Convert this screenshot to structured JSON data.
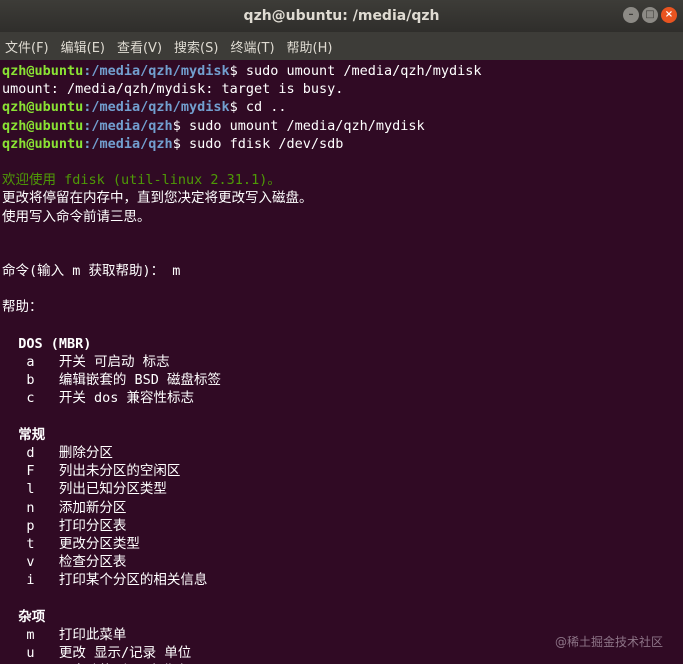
{
  "window": {
    "title": "qzh@ubuntu: /media/qzh",
    "controls": {
      "minimize": "–",
      "maximize": "□",
      "close": "×"
    }
  },
  "menu": [
    "文件(F)",
    "编辑(E)",
    "查看(V)",
    "搜索(S)",
    "终端(T)",
    "帮助(H)"
  ],
  "colors": {
    "background": "#300a24",
    "user": "#8ae234",
    "path": "#729fcf",
    "green": "#4e9a06"
  },
  "terminal": {
    "lines": [
      {
        "user": "qzh@ubuntu",
        "path": ":/media/qzh/mydisk",
        "cmd": "$ sudo umount /media/qzh/mydisk"
      },
      {
        "text": "umount: /media/qzh/mydisk: target is busy."
      },
      {
        "user": "qzh@ubuntu",
        "path": ":/media/qzh/mydisk",
        "cmd": "$ cd .."
      },
      {
        "user": "qzh@ubuntu",
        "path": ":/media/qzh",
        "cmd": "$ sudo umount /media/qzh/mydisk"
      },
      {
        "user": "qzh@ubuntu",
        "path": ":/media/qzh",
        "cmd": "$ sudo fdisk /dev/sdb"
      },
      {
        "text": ""
      },
      {
        "text": "欢迎使用 fdisk (util-linux 2.31.1)。",
        "style": "green"
      },
      {
        "text": "更改将停留在内存中，直到您决定将更改写入磁盘。"
      },
      {
        "text": "使用写入命令前请三思。"
      },
      {
        "text": ""
      },
      {
        "text": ""
      },
      {
        "text": "命令(输入 m 获取帮助)： m"
      },
      {
        "text": ""
      },
      {
        "text": "帮助："
      },
      {
        "text": ""
      },
      {
        "text": "  DOS (MBR)",
        "style": "bold"
      },
      {
        "text": "   a   开关 可启动 标志"
      },
      {
        "text": "   b   编辑嵌套的 BSD 磁盘标签"
      },
      {
        "text": "   c   开关 dos 兼容性标志"
      },
      {
        "text": ""
      },
      {
        "text": "  常规",
        "style": "bold"
      },
      {
        "text": "   d   删除分区"
      },
      {
        "text": "   F   列出未分区的空闲区"
      },
      {
        "text": "   l   列出已知分区类型"
      },
      {
        "text": "   n   添加新分区"
      },
      {
        "text": "   p   打印分区表"
      },
      {
        "text": "   t   更改分区类型"
      },
      {
        "text": "   v   检查分区表"
      },
      {
        "text": "   i   打印某个分区的相关信息"
      },
      {
        "text": ""
      },
      {
        "text": "  杂项",
        "style": "bold"
      },
      {
        "text": "   m   打印此菜单"
      },
      {
        "text": "   u   更改 显示/记录 单位"
      },
      {
        "text": "   x   更多功能(仅限专业人员)"
      }
    ]
  },
  "watermark": "@稀土掘金技术社区"
}
